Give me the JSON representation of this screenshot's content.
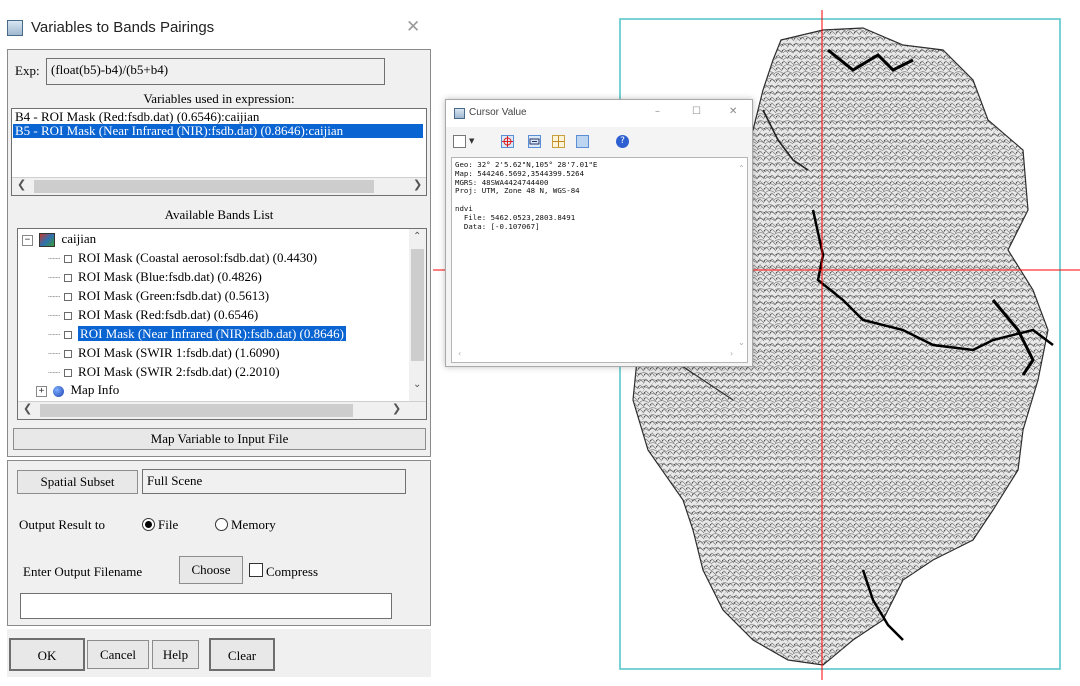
{
  "dialog": {
    "title": "Variables to Bands Pairings",
    "close_glyph": "✕",
    "exp_label": "Exp:",
    "expression": "(float(b5)-b4)/(b5+b4)",
    "variables_label": "Variables used in expression:",
    "variables": [
      {
        "text": "B4 - ROI Mask (Red:fsdb.dat) (0.6546):caijian",
        "selected": false
      },
      {
        "text": "B5 - ROI Mask (Near Infrared (NIR):fsdb.dat) (0.8646):caijian",
        "selected": true
      }
    ],
    "bands_label": "Available Bands List",
    "tree_root": "caijian",
    "bands": [
      {
        "text": "ROI Mask (Coastal aerosol:fsdb.dat) (0.4430)",
        "selected": false
      },
      {
        "text": "ROI Mask (Blue:fsdb.dat) (0.4826)",
        "selected": false
      },
      {
        "text": "ROI Mask (Green:fsdb.dat) (0.5613)",
        "selected": false
      },
      {
        "text": "ROI Mask (Red:fsdb.dat) (0.6546)",
        "selected": false
      },
      {
        "text": "ROI Mask (Near Infrared (NIR):fsdb.dat) (0.8646)",
        "selected": true
      },
      {
        "text": "ROI Mask (SWIR 1:fsdb.dat) (1.6090)",
        "selected": false
      },
      {
        "text": "ROI Mask (SWIR 2:fsdb.dat) (2.2010)",
        "selected": false
      }
    ],
    "map_info": "Map Info",
    "map_variable_button": "Map Variable to Input File",
    "spatial_subset_button": "Spatial Subset",
    "spatial_subset_value": "Full Scene",
    "output_label": "Output Result to",
    "output_file": "File",
    "output_memory": "Memory",
    "output_selected": "File",
    "filename_label": "Enter Output Filename",
    "choose_button": "Choose",
    "compress_label": "Compress",
    "compress_checked": false,
    "output_filename": "",
    "ok_button": "OK",
    "cancel_button": "Cancel",
    "help_button": "Help",
    "clear_button": "Clear"
  },
  "cursor_window": {
    "title": "Cursor Value",
    "minimize": "–",
    "maximize": "☐",
    "close": "✕",
    "lines": [
      "Geo: 32° 2'5.62\"N,105° 28'7.01\"E",
      "Map: 544246.5692,3544399.5264",
      "MGRS: 48SWA4424744400",
      "Proj: UTM, Zone 48 N, WGS-84",
      "",
      "ndvi",
      "  File: 5462.0523,2803.8491",
      "  Data: [-0.107067]"
    ]
  },
  "colors": {
    "selection": "#0a64d2",
    "crosshair": "#ff0000",
    "extent_box": "#4fc3c8"
  }
}
